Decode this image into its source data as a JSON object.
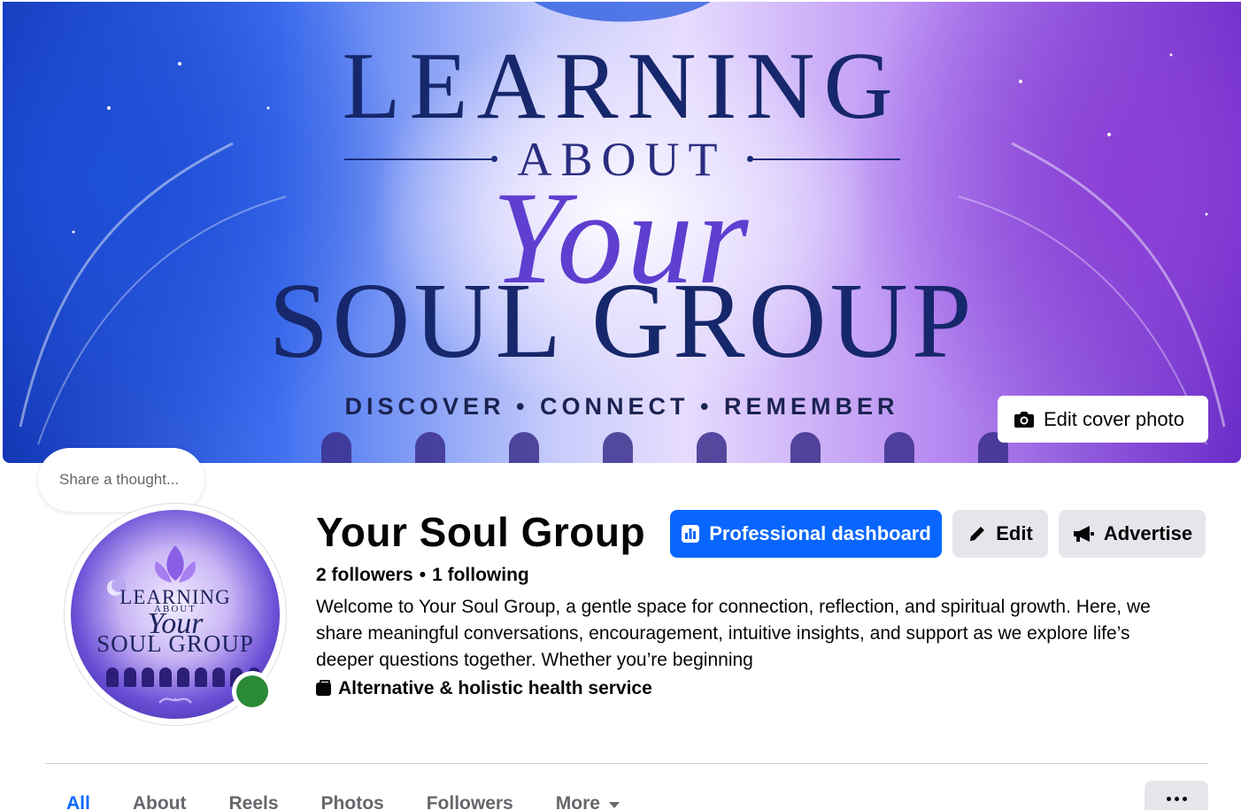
{
  "cover": {
    "line1": "LEARNING",
    "line2": "ABOUT",
    "line3": "Your",
    "line4": "SOUL GROUP",
    "tagline": "DISCOVER • CONNECT • REMEMBER",
    "edit_label": "Edit cover photo"
  },
  "thought": {
    "placeholder": "Share a thought..."
  },
  "avatar": {
    "line1": "LEARNING",
    "line2": "ABOUT",
    "line3": "Your",
    "line4": "SOUL GROUP",
    "status": "online"
  },
  "profile": {
    "name": "Your Soul Group",
    "followers": "2 followers",
    "separator": "•",
    "following": "1 following",
    "bio": "Welcome to Your Soul Group, a gentle space for connection, reflection, and spiritual growth. Here, we share meaningful conversations, encouragement, intuitive insights, and support as we explore life’s deeper questions together. Whether you’re beginning",
    "category": "Alternative & holistic health service"
  },
  "actions": {
    "dashboard": "Professional dashboard",
    "edit": "Edit",
    "advertise": "Advertise"
  },
  "tabs": [
    "All",
    "About",
    "Reels",
    "Photos",
    "Followers",
    "More"
  ],
  "colors": {
    "accent": "#0866ff",
    "secondary_bg": "#e4e6eb",
    "online": "#2a8a35"
  }
}
